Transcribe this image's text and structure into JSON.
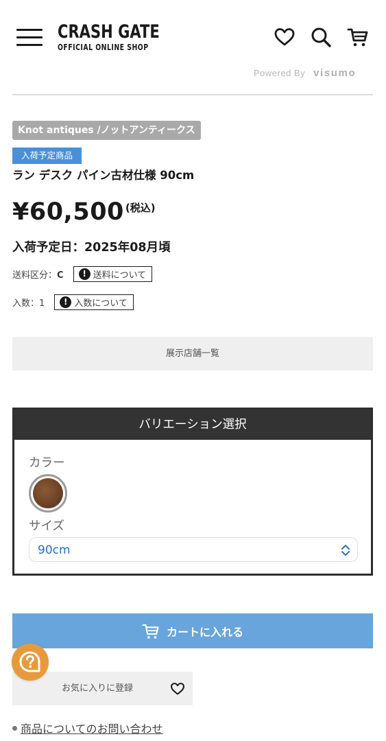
{
  "header": {
    "logo_main": "CRASH GATE",
    "logo_sub": "OFFICIAL ONLINE SHOP",
    "icons": [
      "menu-icon",
      "heart-icon",
      "search-icon",
      "cart-icon"
    ],
    "powered_by": "Powered By",
    "powered_brand": "visumo"
  },
  "product": {
    "brand": "Knot antiques /ノットアンティークス",
    "status_badge": "入荷予定商品",
    "title": "ラン デスク パイン古材仕様 90cm",
    "price": "¥60,500",
    "price_tax": "(税込)",
    "arrival": "入荷予定日：2025年08月頃",
    "shipping_label": "送料区分：",
    "shipping_value": "C",
    "shipping_button": "送料について",
    "qty_label": "入数：1",
    "qty_button": "入数について"
  },
  "store_button": "展示店舗一覧",
  "variation": {
    "title": "バリエーション選択",
    "color_label": "カラー",
    "size_label": "サイズ",
    "size_selected": "90cm"
  },
  "cart_button": "カートに入れる",
  "favorite_button": "お気に入りに登録",
  "contact_link": "商品についてのお問い合わせ",
  "colors": {
    "accent_blue": "#4a90d9",
    "cart_button": "#68a5dc",
    "help_button": "#e79a3c",
    "brand_tag": "#a9a9a9",
    "variation_header": "#333333"
  }
}
